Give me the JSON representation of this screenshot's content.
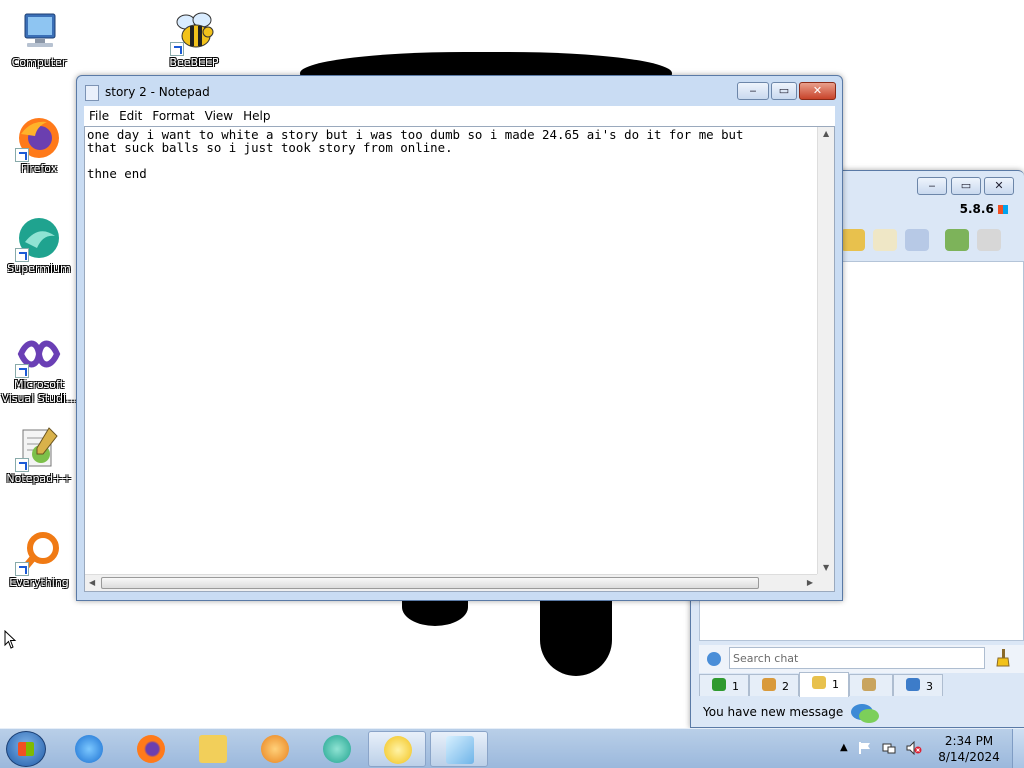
{
  "desktop": {
    "icons": [
      {
        "label": "Computer",
        "icon": "computer-icon"
      },
      {
        "label": "BeeBEEP",
        "icon": "bee-icon"
      },
      {
        "label": "Firefox",
        "icon": "firefox-icon"
      },
      {
        "label": "Supermium",
        "icon": "supermium-icon"
      },
      {
        "label": "Microsoft Visual Studi...",
        "icon": "visual-studio-icon"
      },
      {
        "label": "Notepad++",
        "icon": "notepadpp-icon"
      },
      {
        "label": "Everything",
        "icon": "everything-icon"
      }
    ]
  },
  "notepad": {
    "title": "story 2 - Notepad",
    "menu": [
      "File",
      "Edit",
      "Format",
      "View",
      "Help"
    ],
    "content": "one day i want to white a story but i was too dumb so i made 24.65 ai's do it for me but\nthat suck balls so i just took story from online.\n\nthne end",
    "minimize_label": "‒",
    "maximize_label": "▭",
    "close_label": "✕"
  },
  "beebeep": {
    "version": "5.8.6",
    "search_placeholder": "Search chat",
    "tabs": [
      {
        "count": "1",
        "icon": "users-online-icon"
      },
      {
        "count": "2",
        "icon": "groups-icon"
      },
      {
        "count": "1",
        "icon": "chats-icon"
      },
      {
        "count": "",
        "icon": "shares-icon"
      },
      {
        "count": "3",
        "icon": "network-icon"
      }
    ],
    "status": "You have new message",
    "minimize_label": "‒",
    "maximize_label": "▭",
    "close_label": "✕"
  },
  "taskbar": {
    "apps": [
      "internet-explorer-icon",
      "firefox-icon",
      "explorer-icon",
      "media-player-icon",
      "supermium-icon",
      "beebeep-icon",
      "notepad-icon"
    ],
    "clock_time": "2:34 PM",
    "clock_date": "8/14/2024"
  }
}
